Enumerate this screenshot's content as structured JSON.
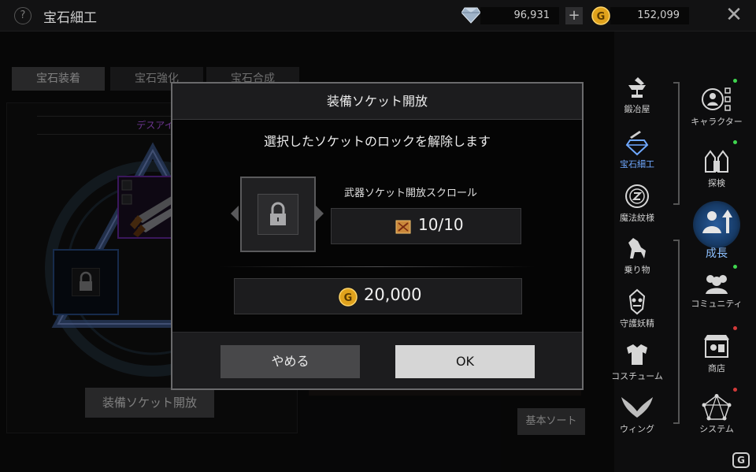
{
  "header": {
    "title": "宝石細工",
    "help_label": "?",
    "diamond_amount": "96,931",
    "plus_label": "+",
    "gold_amount": "152,099",
    "close_label": "✕"
  },
  "tabs": [
    {
      "label": "宝石装着",
      "active": true
    },
    {
      "label": "宝石強化",
      "active": false
    },
    {
      "label": "宝石合成",
      "active": false
    }
  ],
  "panel": {
    "item_name": "デスアイ",
    "open_socket_button": "装備ソケット開放",
    "sort_button": "基本ソート"
  },
  "sidebar_left": [
    {
      "label": "鍛冶屋",
      "icon": "anvil-icon",
      "selected": false
    },
    {
      "label": "宝石細工",
      "icon": "gem-icon",
      "selected": true
    },
    {
      "label": "魔法紋様",
      "icon": "rune-icon",
      "selected": false
    },
    {
      "label": "乗り物",
      "icon": "horse-icon",
      "selected": false
    },
    {
      "label": "守護妖精",
      "icon": "fairy-icon",
      "selected": false
    },
    {
      "label": "コスチューム",
      "icon": "armor-icon",
      "selected": false
    },
    {
      "label": "ウィング",
      "icon": "wings-icon",
      "selected": false
    }
  ],
  "sidebar_right": [
    {
      "label": "キャラクター",
      "icon": "character-icon",
      "dot": "green"
    },
    {
      "label": "探検",
      "icon": "explore-icon",
      "dot": "green"
    },
    {
      "label": "成長",
      "icon": "growth-icon",
      "dot": "none"
    },
    {
      "label": "コミュニティ",
      "icon": "community-icon",
      "dot": "green"
    },
    {
      "label": "商店",
      "icon": "shop-icon",
      "dot": "red"
    },
    {
      "label": "システム",
      "icon": "system-icon",
      "dot": "red"
    }
  ],
  "dialog": {
    "title": "装備ソケット開放",
    "message": "選択したソケットのロックを解除します",
    "scroll_name": "武器ソケット開放スクロール",
    "scroll_count": "10/10",
    "cost": "20,000",
    "cancel_label": "やめる",
    "ok_label": "OK"
  },
  "watermark": "G",
  "colors": {
    "selected_blue": "#6fa8ff",
    "item_purple": "#c060ff",
    "dot_green": "#3fd64f",
    "dot_red": "#d33a3a",
    "gold": "#e0a21c"
  }
}
